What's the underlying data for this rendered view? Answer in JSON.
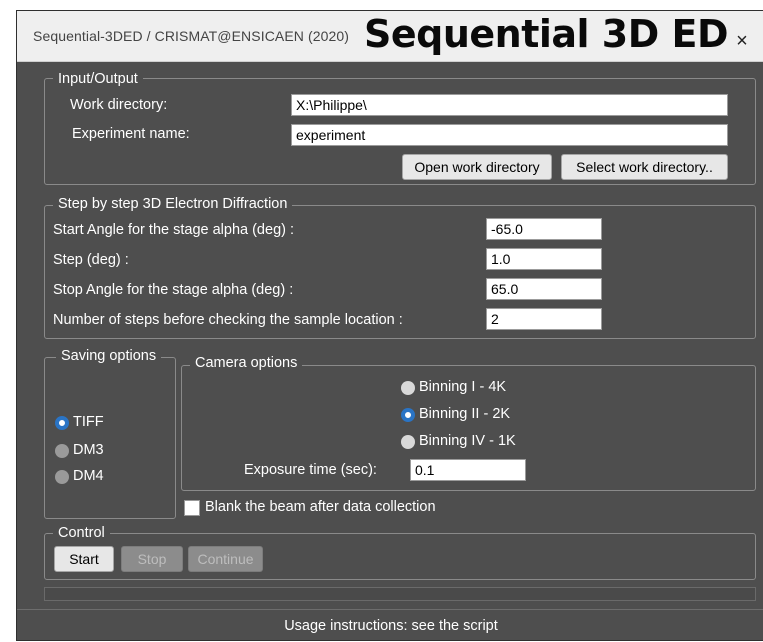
{
  "window": {
    "title_small": "Sequential-3DED / CRISMAT@ENSICAEN (2020)",
    "title_big": "Sequential 3D ED",
    "close_glyph": "×"
  },
  "io": {
    "legend": "Input/Output",
    "workdir_label": "Work directory:",
    "workdir_value": "X:\\Philippe\\",
    "expname_label": "Experiment name:",
    "expname_value": "experiment",
    "open_button": "Open work directory",
    "select_button": "Select work directory.."
  },
  "ed": {
    "legend": "Step by step 3D Electron Diffraction",
    "start_label": "Start Angle for the stage alpha (deg) :",
    "start_value": "-65.0",
    "step_label": "Step (deg) :",
    "step_value": "1.0",
    "stop_label": "Stop Angle for the stage alpha (deg) :",
    "stop_value": "65.0",
    "check_label": "Number of steps before checking the sample location :",
    "check_value": "2"
  },
  "saving": {
    "legend": "Saving options",
    "options": [
      "TIFF",
      "DM3",
      "DM4"
    ],
    "selected": "TIFF"
  },
  "camera": {
    "legend": "Camera options",
    "binning": [
      "Binning I - 4K",
      "Binning II - 2K",
      "Binning IV - 1K"
    ],
    "selected": "Binning II - 2K",
    "exposure_label": "Exposure time (sec):",
    "exposure_value": "0.1"
  },
  "blank": {
    "label": "Blank the beam after data collection",
    "checked": false
  },
  "control": {
    "legend": "Control",
    "start": "Start",
    "stop": "Stop",
    "continue": "Continue"
  },
  "progress": {
    "value": 0
  },
  "status": "Usage instructions: see the script",
  "colors": {
    "panel_bg": "#4e4e4e",
    "accent": "#2a74c5"
  },
  "icons": {
    "close": "close-icon",
    "radio": "radio-button-icon",
    "checkbox": "checkbox-icon"
  }
}
